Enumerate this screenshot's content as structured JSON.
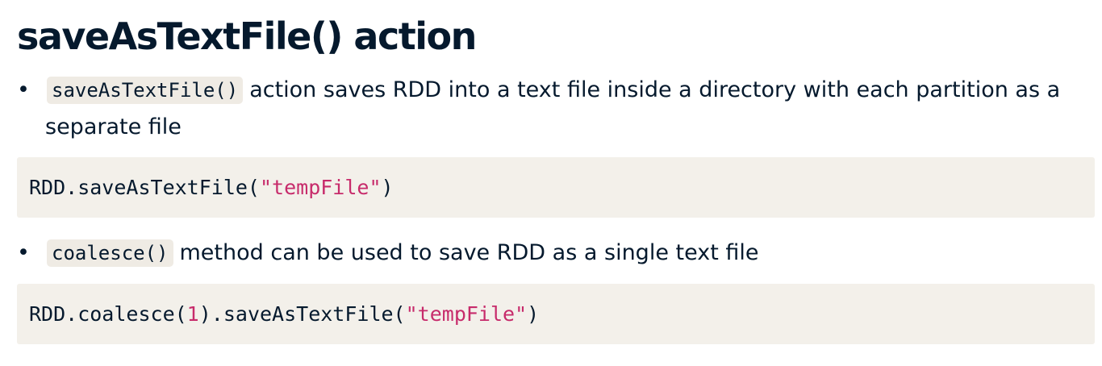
{
  "slide": {
    "title": "saveAsTextFile() action",
    "bullets": [
      {
        "bullet_char": "•",
        "code": "saveAsTextFile()",
        "text": "action saves RDD into a text file inside a directory with each partition as a separate file"
      },
      {
        "bullet_char": "•",
        "code": "coalesce()",
        "text": "method can be used to save RDD as a single text file"
      }
    ],
    "code_blocks": [
      {
        "prefix": "RDD.saveAsTextFile(",
        "string": "\"tempFile\"",
        "suffix": ")"
      },
      {
        "prefix": "RDD.coalesce(",
        "number": "1",
        "middle": ").saveAsTextFile(",
        "string": "\"tempFile\"",
        "suffix": ")"
      }
    ]
  },
  "colors": {
    "text": "#05192d",
    "code_background": "#f3f0ea",
    "inline_code_background": "#efebe4",
    "string_literal": "#c72b6b"
  }
}
